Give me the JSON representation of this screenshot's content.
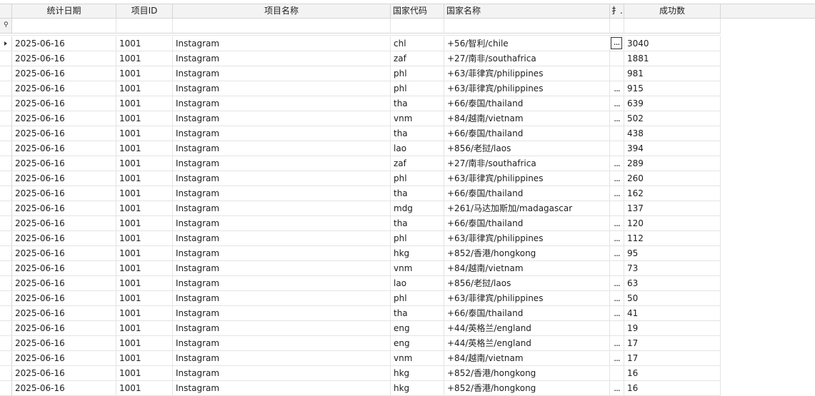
{
  "columns": {
    "date": "统计日期",
    "project_id": "项目ID",
    "project_name": "项目名称",
    "country_code": "国家代码",
    "country_name": "国家名称",
    "action": "扌..",
    "success_count": "成功数"
  },
  "filter_icon": "filter-pin-icon",
  "rows": [
    {
      "date": "2025-06-16",
      "project_id": "1001",
      "project_name": "Instagram",
      "country_code": "chl",
      "country_name": "+56/智利/chile",
      "action": "...",
      "success_count": "3040",
      "selected": true
    },
    {
      "date": "2025-06-16",
      "project_id": "1001",
      "project_name": "Instagram",
      "country_code": "zaf",
      "country_name": "+27/南非/southafrica",
      "action": "",
      "success_count": "1881"
    },
    {
      "date": "2025-06-16",
      "project_id": "1001",
      "project_name": "Instagram",
      "country_code": "phl",
      "country_name": "+63/菲律宾/philippines",
      "action": "",
      "success_count": "981"
    },
    {
      "date": "2025-06-16",
      "project_id": "1001",
      "project_name": "Instagram",
      "country_code": "phl",
      "country_name": "+63/菲律宾/philippines",
      "action": "...",
      "success_count": "915"
    },
    {
      "date": "2025-06-16",
      "project_id": "1001",
      "project_name": "Instagram",
      "country_code": "tha",
      "country_name": "+66/泰国/thailand",
      "action": "...",
      "success_count": "639"
    },
    {
      "date": "2025-06-16",
      "project_id": "1001",
      "project_name": "Instagram",
      "country_code": "vnm",
      "country_name": "+84/越南/vietnam",
      "action": "...",
      "success_count": "502"
    },
    {
      "date": "2025-06-16",
      "project_id": "1001",
      "project_name": "Instagram",
      "country_code": "tha",
      "country_name": "+66/泰国/thailand",
      "action": "",
      "success_count": "438"
    },
    {
      "date": "2025-06-16",
      "project_id": "1001",
      "project_name": "Instagram",
      "country_code": "lao",
      "country_name": "+856/老挝/laos",
      "action": "",
      "success_count": "394"
    },
    {
      "date": "2025-06-16",
      "project_id": "1001",
      "project_name": "Instagram",
      "country_code": "zaf",
      "country_name": "+27/南非/southafrica",
      "action": "...",
      "success_count": "289"
    },
    {
      "date": "2025-06-16",
      "project_id": "1001",
      "project_name": "Instagram",
      "country_code": "phl",
      "country_name": "+63/菲律宾/philippines",
      "action": "...",
      "success_count": "260"
    },
    {
      "date": "2025-06-16",
      "project_id": "1001",
      "project_name": "Instagram",
      "country_code": "tha",
      "country_name": "+66/泰国/thailand",
      "action": "...",
      "success_count": "162"
    },
    {
      "date": "2025-06-16",
      "project_id": "1001",
      "project_name": "Instagram",
      "country_code": "mdg",
      "country_name": "+261/马达加斯加/madagascar",
      "action": "",
      "success_count": "137"
    },
    {
      "date": "2025-06-16",
      "project_id": "1001",
      "project_name": "Instagram",
      "country_code": "tha",
      "country_name": "+66/泰国/thailand",
      "action": "...",
      "success_count": "120"
    },
    {
      "date": "2025-06-16",
      "project_id": "1001",
      "project_name": "Instagram",
      "country_code": "phl",
      "country_name": "+63/菲律宾/philippines",
      "action": "...",
      "success_count": "112"
    },
    {
      "date": "2025-06-16",
      "project_id": "1001",
      "project_name": "Instagram",
      "country_code": "hkg",
      "country_name": "+852/香港/hongkong",
      "action": "...",
      "success_count": "95"
    },
    {
      "date": "2025-06-16",
      "project_id": "1001",
      "project_name": "Instagram",
      "country_code": "vnm",
      "country_name": "+84/越南/vietnam",
      "action": "",
      "success_count": "73"
    },
    {
      "date": "2025-06-16",
      "project_id": "1001",
      "project_name": "Instagram",
      "country_code": "lao",
      "country_name": "+856/老挝/laos",
      "action": "...",
      "success_count": "63"
    },
    {
      "date": "2025-06-16",
      "project_id": "1001",
      "project_name": "Instagram",
      "country_code": "phl",
      "country_name": "+63/菲律宾/philippines",
      "action": "...",
      "success_count": "50"
    },
    {
      "date": "2025-06-16",
      "project_id": "1001",
      "project_name": "Instagram",
      "country_code": "tha",
      "country_name": "+66/泰国/thailand",
      "action": "...",
      "success_count": "41"
    },
    {
      "date": "2025-06-16",
      "project_id": "1001",
      "project_name": "Instagram",
      "country_code": "eng",
      "country_name": "+44/英格兰/england",
      "action": "",
      "success_count": "19"
    },
    {
      "date": "2025-06-16",
      "project_id": "1001",
      "project_name": "Instagram",
      "country_code": "eng",
      "country_name": "+44/英格兰/england",
      "action": "...",
      "success_count": "17"
    },
    {
      "date": "2025-06-16",
      "project_id": "1001",
      "project_name": "Instagram",
      "country_code": "vnm",
      "country_name": "+84/越南/vietnam",
      "action": "...",
      "success_count": "17"
    },
    {
      "date": "2025-06-16",
      "project_id": "1001",
      "project_name": "Instagram",
      "country_code": "hkg",
      "country_name": "+852/香港/hongkong",
      "action": "",
      "success_count": "16"
    },
    {
      "date": "2025-06-16",
      "project_id": "1001",
      "project_name": "Instagram",
      "country_code": "hkg",
      "country_name": "+852/香港/hongkong",
      "action": "...",
      "success_count": "16"
    }
  ]
}
